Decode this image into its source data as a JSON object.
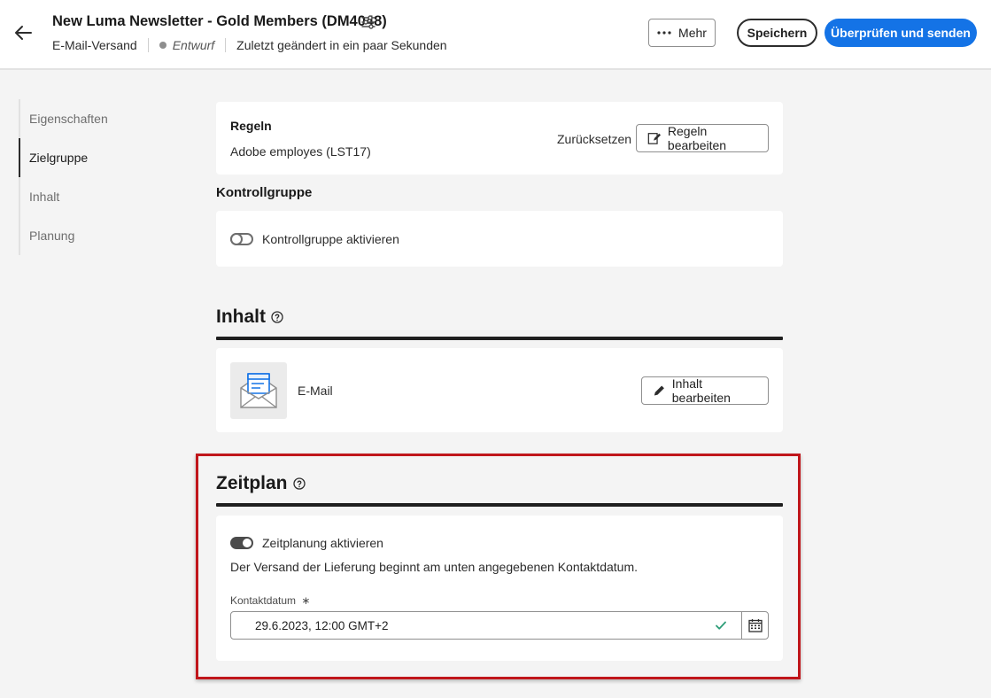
{
  "header": {
    "title": "New Luma Newsletter - Gold Members (DM4048)",
    "type": "E-Mail-Versand",
    "status": "Entwurf",
    "last_modified": "Zuletzt geändert in ein paar Sekunden",
    "more_label": "Mehr",
    "save_label": "Speichern",
    "send_label": "Überprüfen und senden"
  },
  "nav": {
    "items": [
      {
        "label": "Eigenschaften",
        "active": false
      },
      {
        "label": "Zielgruppe",
        "active": true
      },
      {
        "label": "Inhalt",
        "active": false
      },
      {
        "label": "Planung",
        "active": false
      }
    ]
  },
  "rules": {
    "title": "Regeln",
    "value": "Adobe employes (LST17)",
    "reset_label": "Zurücksetzen",
    "edit_label": "Regeln bearbeiten"
  },
  "control_group": {
    "heading": "Kontrollgruppe",
    "toggle_label": "Kontrollgruppe aktivieren",
    "enabled": false
  },
  "content": {
    "heading": "Inhalt",
    "channel_label": "E-Mail",
    "edit_label": "Inhalt bearbeiten"
  },
  "schedule": {
    "heading": "Zeitplan",
    "toggle_label": "Zeitplanung aktivieren",
    "enabled": true,
    "description": "Der Versand der Lieferung beginnt am unten angegebenen Kontaktdatum.",
    "field_label": "Kontaktdatum",
    "required_mark": "∗",
    "field_value": "29.6.2023, 12:00 GMT+2"
  },
  "colors": {
    "accent": "#1473e6",
    "highlight": "#c0161b",
    "valid": "#2d9d78"
  }
}
